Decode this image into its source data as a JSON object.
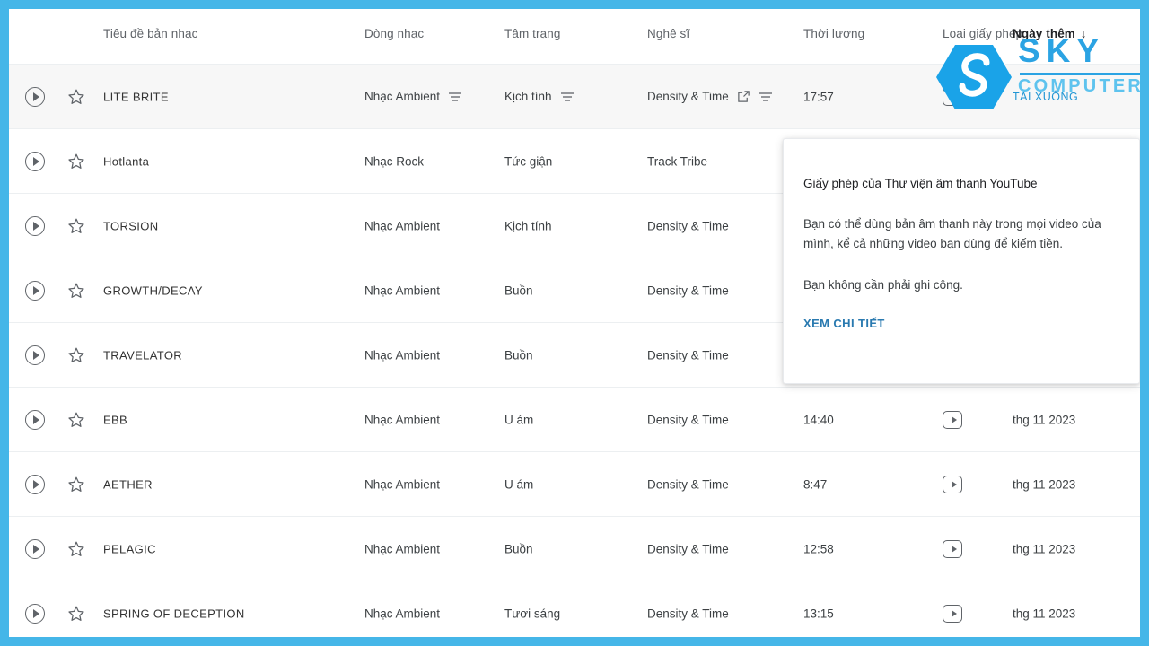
{
  "table": {
    "headers": [
      {
        "key": "play",
        "label": ""
      },
      {
        "key": "star",
        "label": ""
      },
      {
        "key": "title",
        "label": "Tiêu đề bản nhạc"
      },
      {
        "key": "genre",
        "label": "Dòng nhạc"
      },
      {
        "key": "mood",
        "label": "Tâm trạng"
      },
      {
        "key": "artist",
        "label": "Nghệ sĩ"
      },
      {
        "key": "duration",
        "label": "Thời lượng"
      },
      {
        "key": "license",
        "label": "Loại giấy phép"
      },
      {
        "key": "added",
        "label": "Ngày thêm"
      }
    ],
    "sort": {
      "column": "Ngày thêm",
      "arrow": "↓",
      "direction": "descending"
    },
    "rows": [
      {
        "title": "LITE BRITE",
        "genre": "Nhạc Ambient",
        "mood": "Kịch tính",
        "artist": "Density & Time",
        "duration": "17:57",
        "license": "youtube-audio-library",
        "added": "",
        "download_label": "TẢI XUỐNG",
        "active": true,
        "genre_filter_icon": true,
        "mood_filter_icon": true,
        "artist_link_icon": true,
        "artist_filter_icon": true
      },
      {
        "title": "Hotlanta",
        "genre": "Nhạc Rock",
        "mood": "Tức giận",
        "artist": "Track Tribe",
        "duration": "",
        "license": "",
        "added": "",
        "active": false
      },
      {
        "title": "TORSION",
        "genre": "Nhạc Ambient",
        "mood": "Kịch tính",
        "artist": "Density & Time",
        "duration": "",
        "license": "",
        "added": "",
        "active": false
      },
      {
        "title": "GROWTH/DECAY",
        "genre": "Nhạc Ambient",
        "mood": "Buồn",
        "artist": "Density & Time",
        "duration": "",
        "license": "",
        "added": "",
        "active": false
      },
      {
        "title": "TRAVELATOR",
        "genre": "Nhạc Ambient",
        "mood": "Buồn",
        "artist": "Density & Time",
        "duration": "",
        "license": "",
        "added": "",
        "active": false
      },
      {
        "title": "EBB",
        "genre": "Nhạc Ambient",
        "mood": "U ám",
        "artist": "Density & Time",
        "duration": "14:40",
        "license": "youtube-audio-library",
        "added": "thg 11 2023",
        "active": false
      },
      {
        "title": "AETHER",
        "genre": "Nhạc Ambient",
        "mood": "U ám",
        "artist": "Density & Time",
        "duration": "8:47",
        "license": "youtube-audio-library",
        "added": "thg 11 2023",
        "active": false
      },
      {
        "title": "PELAGIC",
        "genre": "Nhạc Ambient",
        "mood": "Buồn",
        "artist": "Density & Time",
        "duration": "12:58",
        "license": "youtube-audio-library",
        "added": "thg 11 2023",
        "active": false
      },
      {
        "title": "SPRING OF DECEPTION",
        "genre": "Nhạc Ambient",
        "mood": "Tươi sáng",
        "artist": "Density & Time",
        "duration": "13:15",
        "license": "youtube-audio-library",
        "added": "thg 11 2023",
        "active": false
      }
    ]
  },
  "tooltip": {
    "title": "Giấy phép của Thư viện âm thanh YouTube",
    "paragraph1": "Bạn có thể dùng bản âm thanh này trong mọi video của mình, kể cả những video bạn dùng để kiếm tiền.",
    "paragraph2": "Bạn không cần phải ghi công.",
    "link": "XEM CHI TIẾT"
  },
  "watermark": {
    "line1": "SKY",
    "line2": "COMPUTER",
    "logo": "sky-hexagon-logo"
  },
  "colors": {
    "accent_blue": "#45b6e8",
    "logo_blue": "#2ba3e3",
    "logo_blue_light": "#5ec3ee",
    "link_blue": "#2196d4",
    "tooltip_link": "#2a7ab0",
    "row_active_bg": "#f7f7f7",
    "text_primary": "#3c4043",
    "text_secondary": "#5f6368"
  }
}
